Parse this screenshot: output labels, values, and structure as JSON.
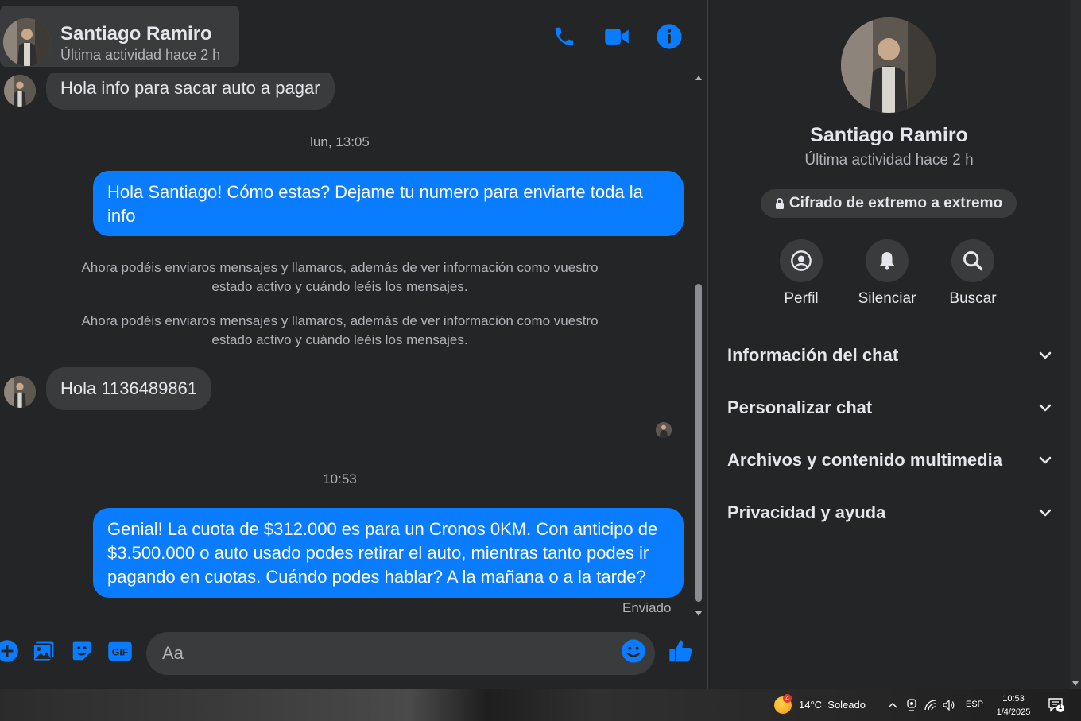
{
  "header": {
    "name": "Santiago Ramiro",
    "status": "Última actividad hace 2 h",
    "icons": [
      "phone-icon",
      "video-icon",
      "info-icon"
    ],
    "accent": "#0a7cff"
  },
  "messages": {
    "first_incoming": "Hola info para sacar auto a pagar",
    "time1": "lun, 13:05",
    "outgoing1": "Hola Santiago! Cómo estas? Dejame tu numero para enviarte toda la info",
    "system1": "Ahora podéis enviaros mensajes y llamaros, además de ver información como vuestro estado activo y cuándo leéis los mensajes.",
    "system2": "Ahora podéis enviaros mensajes y llamaros, además de ver información como vuestro estado activo y cuándo leéis los mensajes.",
    "incoming2": "Hola 1136489861",
    "time2": "10:53",
    "outgoing2": "Genial! La cuota de $312.000 es para un Cronos 0KM. Con anticipo de $3.500.000 o auto usado podes retirar el auto, mientras tanto podes ir pagando en cuotas. Cuándo podes hablar? A la mañana o a la tarde?",
    "sent_status": "Enviado"
  },
  "composer": {
    "placeholder": "Aa",
    "icons": [
      "plus-icon",
      "image-icon",
      "sticker-icon",
      "gif-icon",
      "emoji-icon",
      "like-icon"
    ]
  },
  "side_panel": {
    "name": "Santiago Ramiro",
    "status": "Última actividad hace 2 h",
    "encryption": "Cifrado de extremo a extremo",
    "actions": [
      {
        "label": "Perfil",
        "icon": "profile-icon"
      },
      {
        "label": "Silenciar",
        "icon": "bell-icon"
      },
      {
        "label": "Buscar",
        "icon": "search-icon"
      }
    ],
    "sections": [
      "Información del chat",
      "Personalizar chat",
      "Archivos y contenido multimedia",
      "Privacidad y ayuda"
    ]
  },
  "taskbar": {
    "weather_badge": "4",
    "weather": "14°C  Soleado",
    "lang": "ESP",
    "time": "10:53",
    "date": "1/4/2025",
    "notif_count": "1"
  }
}
